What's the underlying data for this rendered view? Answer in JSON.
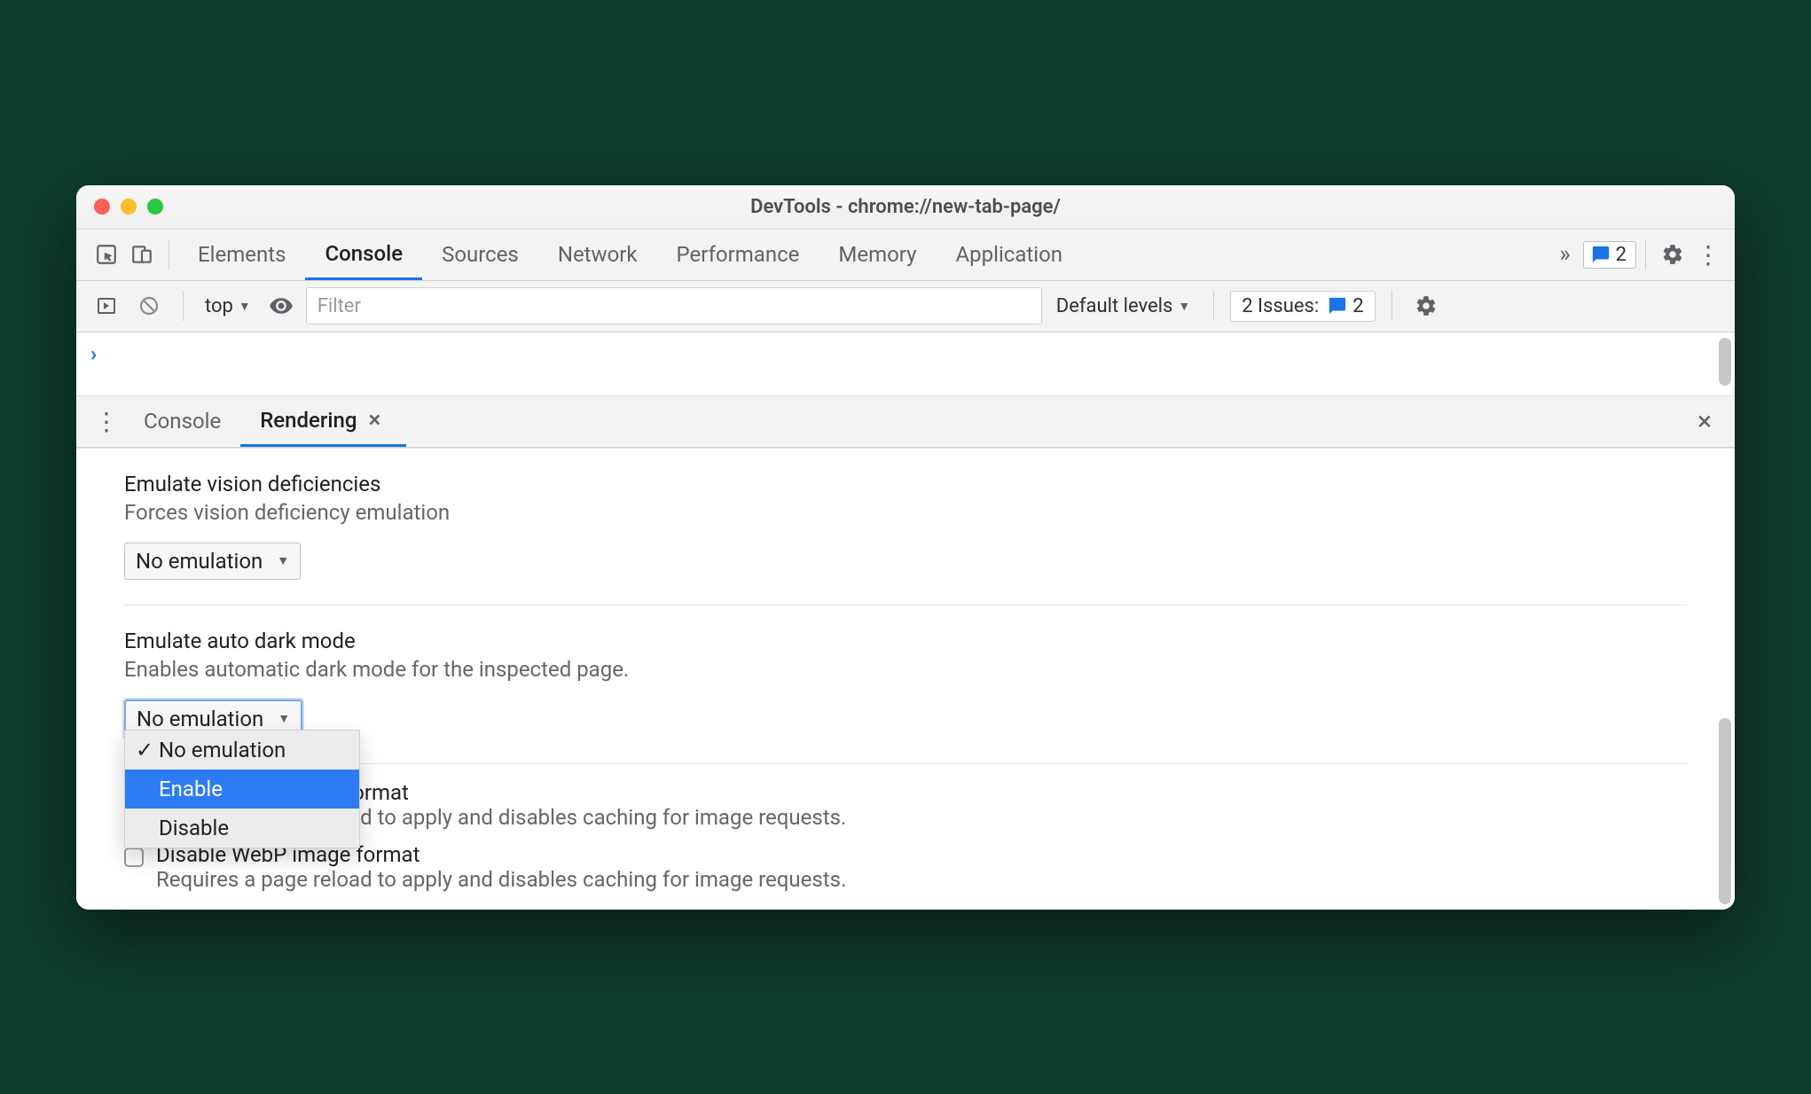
{
  "window": {
    "title": "DevTools - chrome://new-tab-page/"
  },
  "tabs": {
    "items": [
      "Elements",
      "Console",
      "Sources",
      "Network",
      "Performance",
      "Memory",
      "Application"
    ],
    "active": "Console",
    "badge_count": "2"
  },
  "console_toolbar": {
    "context": "top",
    "filter_placeholder": "Filter",
    "levels": "Default levels",
    "issues_label": "2 Issues:",
    "issues_count": "2"
  },
  "drawer": {
    "tabs": [
      "Console",
      "Rendering"
    ],
    "active": "Rendering"
  },
  "rendering": {
    "vision": {
      "title": "Emulate vision deficiencies",
      "desc": "Forces vision deficiency emulation",
      "select_value": "No emulation"
    },
    "darkmode": {
      "title": "Emulate auto dark mode",
      "desc": "Enables automatic dark mode for the inspected page.",
      "select_value": "No emulation",
      "options": [
        "No emulation",
        "Enable",
        "Disable"
      ],
      "selected_index": 0,
      "highlighted_index": 1
    },
    "avif": {
      "title_fragment": "format",
      "desc_fragment": "oad to apply and disables caching for image requests."
    },
    "webp": {
      "title": "Disable WebP image format",
      "desc": "Requires a page reload to apply and disables caching for image requests."
    }
  }
}
